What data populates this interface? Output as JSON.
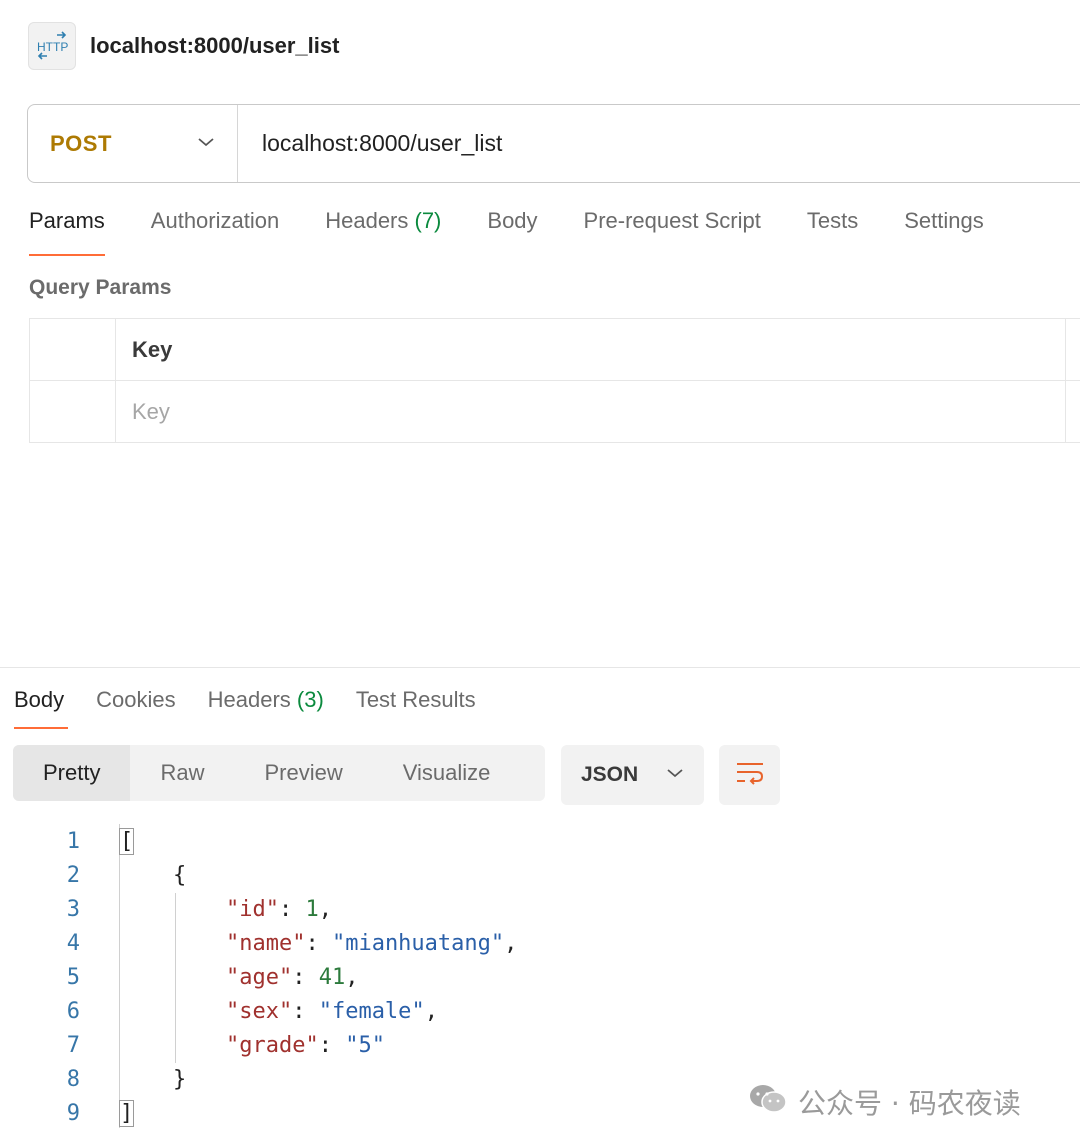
{
  "request": {
    "title": "localhost:8000/user_list",
    "method": "POST",
    "url": "localhost:8000/user_list"
  },
  "request_tabs": [
    {
      "label": "Params",
      "count": ""
    },
    {
      "label": "Authorization",
      "count": ""
    },
    {
      "label": "Headers",
      "count": "(7)"
    },
    {
      "label": "Body",
      "count": ""
    },
    {
      "label": "Pre-request Script",
      "count": ""
    },
    {
      "label": "Tests",
      "count": ""
    },
    {
      "label": "Settings",
      "count": ""
    }
  ],
  "query_params": {
    "label": "Query Params",
    "header_key": "Key",
    "key_placeholder": "Key"
  },
  "response_tabs": [
    {
      "label": "Body",
      "count": ""
    },
    {
      "label": "Cookies",
      "count": ""
    },
    {
      "label": "Headers",
      "count": "(3)"
    },
    {
      "label": "Test Results",
      "count": ""
    }
  ],
  "view_modes": [
    "Pretty",
    "Raw",
    "Preview",
    "Visualize"
  ],
  "format": "JSON",
  "code_lines": [
    {
      "n": "1"
    },
    {
      "n": "2"
    },
    {
      "n": "3"
    },
    {
      "n": "4"
    },
    {
      "n": "5"
    },
    {
      "n": "6"
    },
    {
      "n": "7"
    },
    {
      "n": "8"
    },
    {
      "n": "9"
    }
  ],
  "response_json": [
    {
      "id": 1,
      "name": "mianhuatang",
      "age": 41,
      "sex": "female",
      "grade": "5"
    }
  ],
  "watermark": "公众号 · 码农夜读",
  "colors": {
    "accent": "#ff6c37",
    "method": "#ad7a03",
    "count": "#0b8a3e",
    "json_key": "#a0312e",
    "json_string": "#2a5fa8",
    "json_number": "#2c7a3c"
  }
}
